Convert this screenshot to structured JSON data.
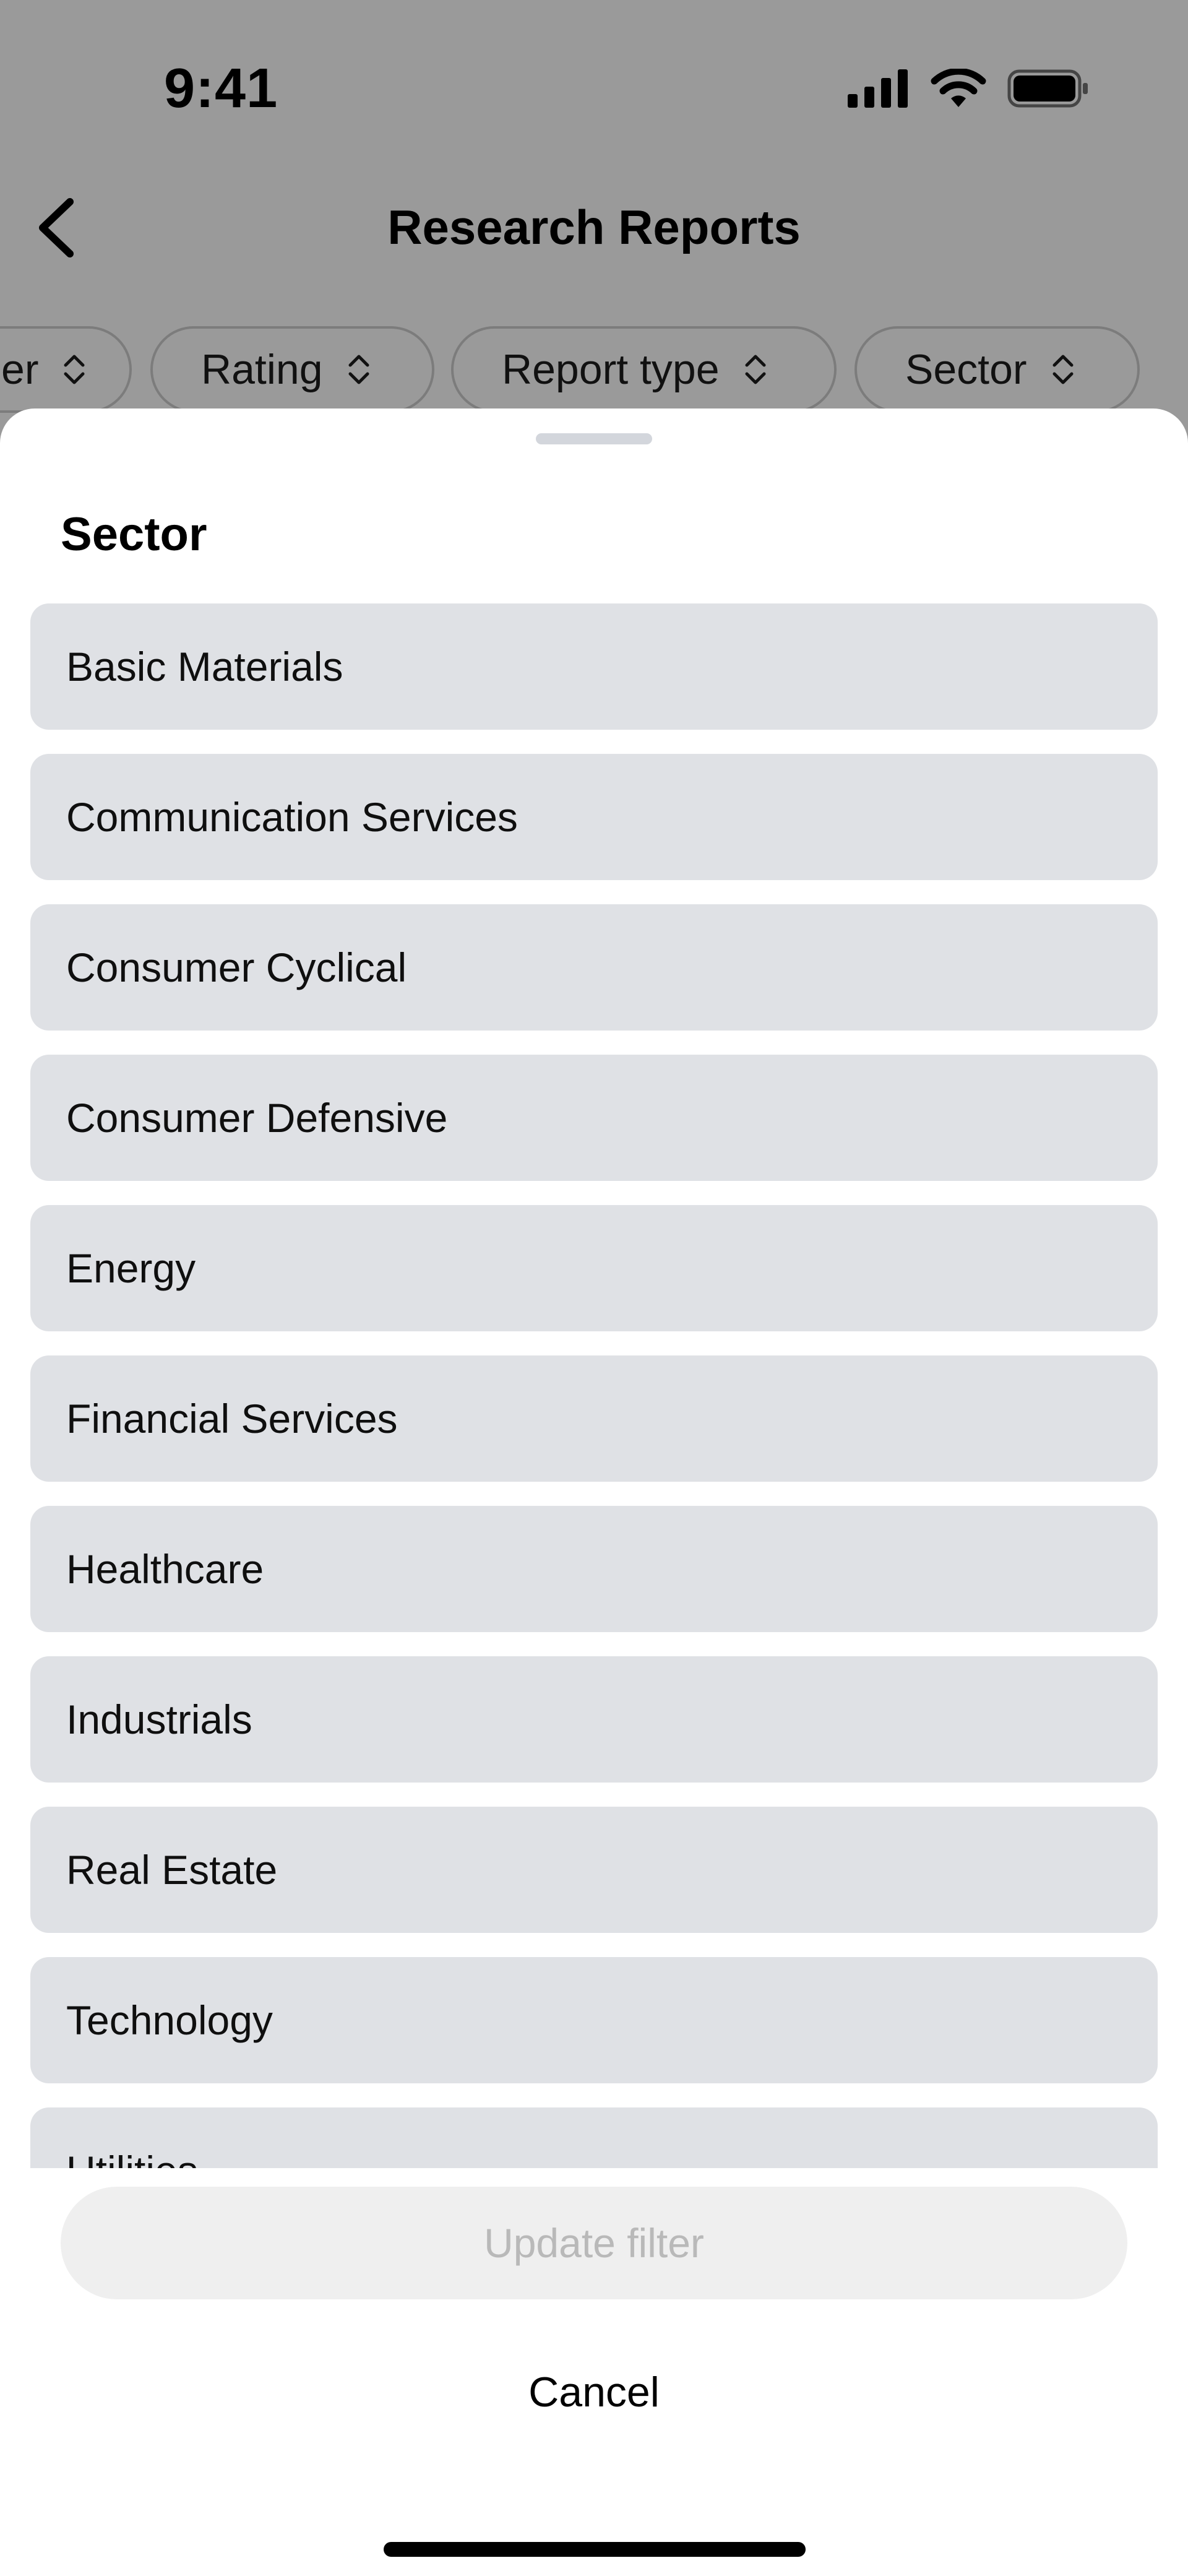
{
  "status_bar": {
    "time": "9:41",
    "icons": [
      "cellular-signal-icon",
      "wifi-icon",
      "battery-icon"
    ]
  },
  "nav": {
    "back_icon": "chevron-left-icon",
    "title": "Research Reports"
  },
  "filter_chips": [
    {
      "label": "er",
      "icon": "up-down-chevron-icon"
    },
    {
      "label": "Rating",
      "icon": "up-down-chevron-icon"
    },
    {
      "label": "Report type",
      "icon": "up-down-chevron-icon"
    },
    {
      "label": "Sector",
      "icon": "up-down-chevron-icon"
    }
  ],
  "sheet": {
    "title": "Sector",
    "options": [
      "Basic Materials",
      "Communication Services",
      "Consumer Cyclical",
      "Consumer Defensive",
      "Energy",
      "Financial Services",
      "Healthcare",
      "Industrials",
      "Real Estate",
      "Technology",
      "Utilities"
    ],
    "update_label": "Update filter",
    "cancel_label": "Cancel"
  },
  "colors": {
    "overlay": "#9a9a9a",
    "option_bg": "#dfe1e5",
    "disabled_button_bg": "#efefef",
    "disabled_button_text": "#b9b9b9"
  }
}
